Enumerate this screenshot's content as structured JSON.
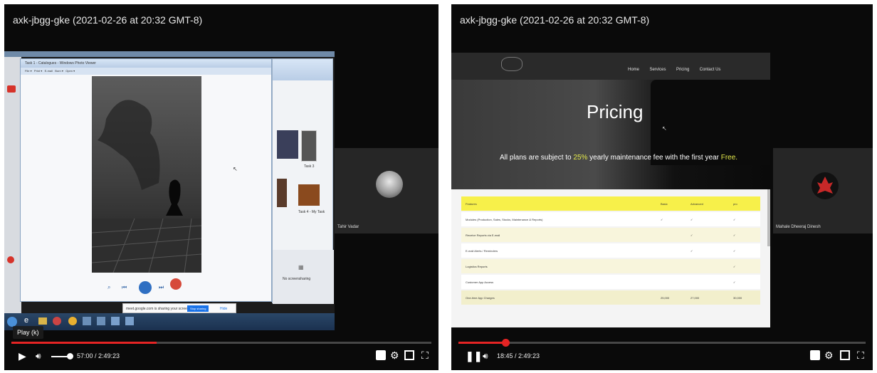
{
  "left_player": {
    "title": "axk-jbgg-gke (2021-02-26 at 20:32 GMT-8)",
    "tooltip": "Play (k)",
    "time": "57:00 / 2:49:23",
    "progress_fraction": 0.345,
    "volume_fraction": 0.6,
    "participant_name": "Tahir Vadar",
    "shared_window_title": "Task 1 - Catalogues - Windows Photo Viewer",
    "shared_window_menu": [
      "File",
      "Print",
      "E-mail",
      "Burn",
      "Open"
    ],
    "share_bar_text": "meet.google.com is sharing your screen",
    "share_stop_label": "Stop sharing",
    "share_hide_label": "Hide",
    "file_label_1": "Task 3",
    "file_label_2": "Task 4 - My Task",
    "panel_label": "No screensharing"
  },
  "right_player": {
    "title": "axk-jbgg-gke (2021-02-26 at 20:32 GMT-8)",
    "time": "18:45 / 2:49:23",
    "progress_fraction": 0.115,
    "participant_name": "Mahale Dheeraj Dinesh",
    "nav": [
      "Home",
      "Services",
      "Pricing",
      "Contact Us"
    ],
    "heading": "Pricing",
    "note_pre": "All plans are subject to ",
    "note_pct": "25%",
    "note_mid": " yearly maintenance fee with the first year ",
    "note_free": "Free.",
    "table_headers": [
      "Features",
      "Basic",
      "Advanced",
      "pro"
    ],
    "table_rows": [
      {
        "feature": "Modules (Production, Sales, Stocks, Maintenance & Reports)",
        "basic": "✓",
        "advanced": "✓",
        "pro": "✓"
      },
      {
        "feature": "Receive Reports via E-mail",
        "basic": "",
        "advanced": "✓",
        "pro": "✓"
      },
      {
        "feature": "E-mail Alerts / Reminders",
        "basic": "",
        "advanced": "✓",
        "pro": "✓"
      },
      {
        "feature": "Logistics Reports",
        "basic": "",
        "advanced": "",
        "pro": "✓"
      },
      {
        "feature": "Customer App Access",
        "basic": "",
        "advanced": "",
        "pro": "✓"
      },
      {
        "feature": "One-time App Charges",
        "basic": "25,000",
        "advanced": "27,000",
        "pro": "30,000"
      }
    ]
  },
  "colors": {
    "progress": "#e52424",
    "table_header": "#f7f04a",
    "highlight": "#e3e84b"
  }
}
